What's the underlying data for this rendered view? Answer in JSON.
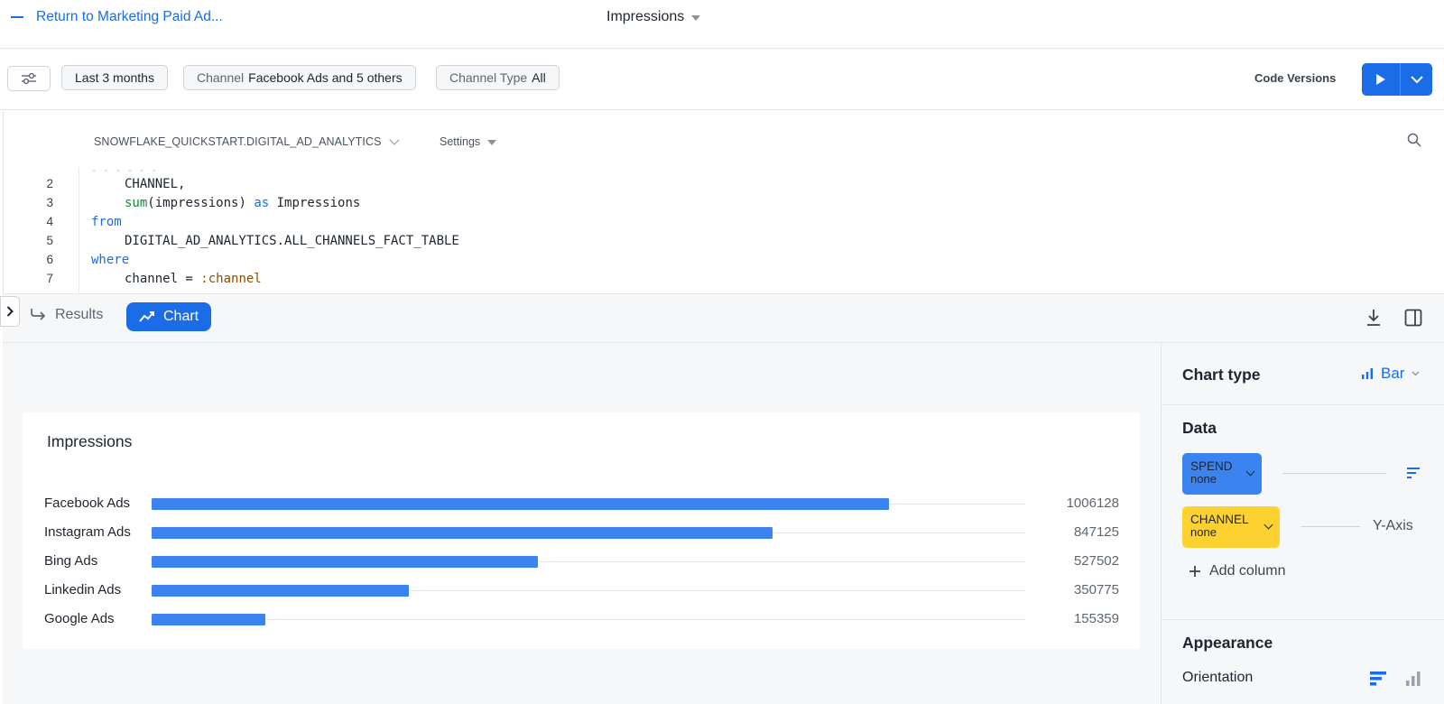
{
  "topbar": {
    "back_label": "Return to Marketing Paid Ad...",
    "title": "Impressions"
  },
  "filters": {
    "date_range": "Last 3 months",
    "channel_key": "Channel",
    "channel_value": "Facebook Ads and 5 others",
    "channel_type_key": "Channel Type",
    "channel_type_value": "All",
    "code_versions": "Code Versions"
  },
  "editor": {
    "database": "SNOWFLAKE_QUICKSTART.DIGITAL_AD_ANALYTICS",
    "settings": "Settings",
    "lines": [
      {
        "num": "2",
        "text": "CHANNEL,"
      },
      {
        "num": "3",
        "fn": "sum",
        "rest": "(impressions) ",
        "kw": "as",
        "tail": " Impressions"
      },
      {
        "num": "4",
        "kw": "from"
      },
      {
        "num": "5",
        "text": "DIGITAL_AD_ANALYTICS.ALL_CHANNELS_FACT_TABLE"
      },
      {
        "num": "6",
        "kw": "where"
      },
      {
        "num": "7",
        "text": "channel = ",
        "param": ":channel"
      }
    ]
  },
  "results_bar": {
    "results_tab": "Results",
    "chart_tab": "Chart"
  },
  "chart_data": {
    "type": "bar",
    "orientation": "horizontal",
    "title": "Impressions",
    "categories": [
      "Facebook Ads",
      "Instagram Ads",
      "Bing Ads",
      "Linkedin Ads",
      "Google Ads"
    ],
    "values": [
      1006128,
      847125,
      527502,
      350775,
      155359
    ],
    "value_labels": [
      "1006128",
      "847125",
      "527502",
      "350775",
      "155359"
    ],
    "bar_color": "#3b84f0"
  },
  "panel": {
    "chart_type_label": "Chart type",
    "chart_type_value": "Bar",
    "data_label": "Data",
    "columns": [
      {
        "name": "SPEND",
        "agg": "none",
        "color": "#3b84f0"
      },
      {
        "name": "CHANNEL",
        "agg": "none",
        "color": "#fdd130",
        "axis": "Y-Axis"
      }
    ],
    "add_column": "Add column",
    "appearance_label": "Appearance",
    "orientation_label": "Orientation"
  },
  "colors": {
    "accent": "#1a6ce7",
    "panel_bg": "#f6f7f8"
  }
}
